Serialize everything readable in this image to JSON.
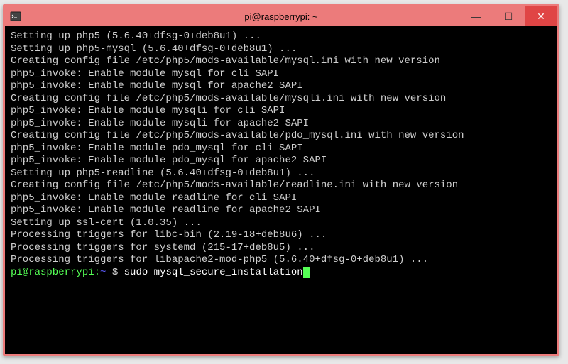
{
  "window": {
    "title": "pi@raspberrypi: ~",
    "controls": {
      "minimize": "—",
      "maximize": "☐",
      "close": "✕"
    }
  },
  "prompt": {
    "user_host": "pi@raspberrypi",
    "colon": ":",
    "path": "~",
    "dollar": " $ ",
    "command": "sudo mysql_secure_installation"
  },
  "output_lines": [
    "Setting up php5 (5.6.40+dfsg-0+deb8u1) ...",
    "Setting up php5-mysql (5.6.40+dfsg-0+deb8u1) ...",
    "",
    "Creating config file /etc/php5/mods-available/mysql.ini with new version",
    "php5_invoke: Enable module mysql for cli SAPI",
    "php5_invoke: Enable module mysql for apache2 SAPI",
    "",
    "Creating config file /etc/php5/mods-available/mysqli.ini with new version",
    "php5_invoke: Enable module mysqli for cli SAPI",
    "php5_invoke: Enable module mysqli for apache2 SAPI",
    "",
    "Creating config file /etc/php5/mods-available/pdo_mysql.ini with new version",
    "php5_invoke: Enable module pdo_mysql for cli SAPI",
    "php5_invoke: Enable module pdo_mysql for apache2 SAPI",
    "Setting up php5-readline (5.6.40+dfsg-0+deb8u1) ...",
    "",
    "Creating config file /etc/php5/mods-available/readline.ini with new version",
    "php5_invoke: Enable module readline for cli SAPI",
    "php5_invoke: Enable module readline for apache2 SAPI",
    "Setting up ssl-cert (1.0.35) ...",
    "Processing triggers for libc-bin (2.19-18+deb8u6) ...",
    "Processing triggers for systemd (215-17+deb8u5) ...",
    "Processing triggers for libapache2-mod-php5 (5.6.40+dfsg-0+deb8u1) ..."
  ]
}
